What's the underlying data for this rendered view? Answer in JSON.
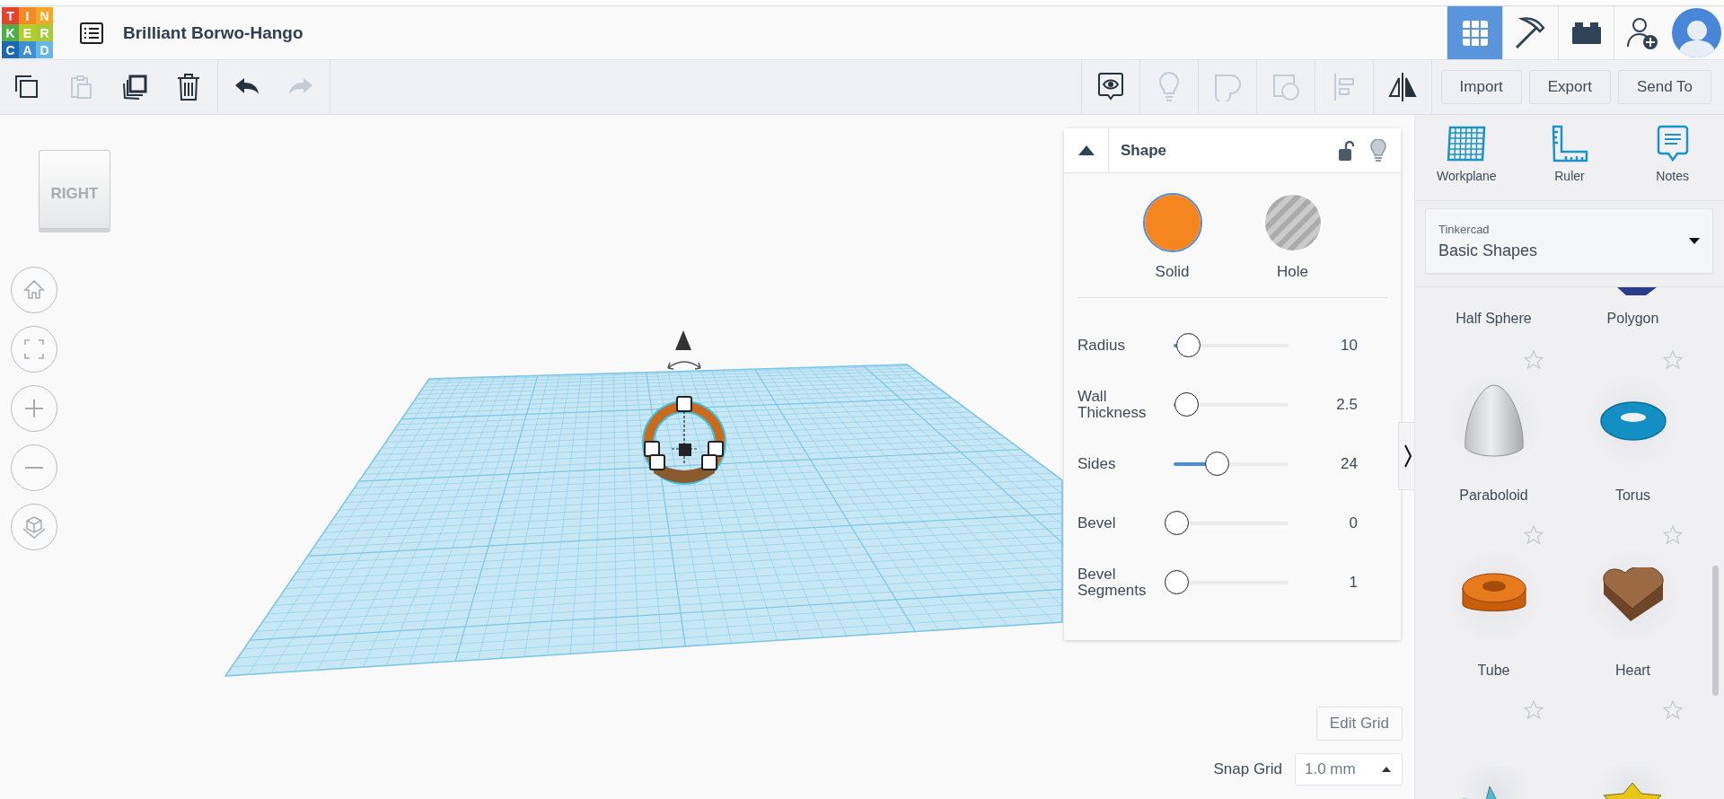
{
  "header": {
    "logo_letters": [
      "T",
      "I",
      "N",
      "K",
      "E",
      "R",
      "C",
      "A",
      "D"
    ],
    "title": "Brilliant Borwo-Hango",
    "views": [
      {
        "kind": "grid",
        "selected": true
      },
      {
        "kind": "pickaxe",
        "selected": false
      },
      {
        "kind": "bricks",
        "selected": false
      }
    ]
  },
  "toolbar": {
    "edit_tools": [
      {
        "kind": "copy",
        "disabled": false
      },
      {
        "kind": "paste",
        "disabled": true
      },
      {
        "kind": "duplicate",
        "disabled": false
      },
      {
        "kind": "delete",
        "disabled": false
      }
    ],
    "history": [
      {
        "kind": "undo",
        "disabled": false
      },
      {
        "kind": "redo",
        "disabled": true
      }
    ],
    "view_tools": [
      {
        "kind": "notes",
        "disabled": false
      },
      {
        "kind": "bulb",
        "disabled": true
      },
      {
        "kind": "group",
        "disabled": true
      },
      {
        "kind": "ungroup",
        "disabled": true
      },
      {
        "kind": "align",
        "disabled": true
      },
      {
        "kind": "mirror",
        "disabled": false
      }
    ],
    "buttons": [
      "Import",
      "Export",
      "Send To"
    ]
  },
  "view_cube": {
    "label": "RIGHT"
  },
  "shape_panel": {
    "title": "Shape",
    "modes": [
      {
        "label": "Solid",
        "kind": "solid",
        "selected": true
      },
      {
        "label": "Hole",
        "kind": "hole",
        "selected": false
      }
    ],
    "params": [
      {
        "name": "Radius",
        "level": 0.13,
        "value": "10"
      },
      {
        "name": "Wall Thickness",
        "level": 0.11,
        "value": "2.5"
      },
      {
        "name": "Sides",
        "level": 0.38,
        "value": "24"
      },
      {
        "name": "Bevel",
        "level": 0.03,
        "value": "0"
      },
      {
        "name": "Bevel Segments",
        "level": 0.03,
        "value": "1"
      }
    ]
  },
  "side_panel": {
    "tools": [
      {
        "label": "Workplane",
        "kind": "workplane"
      },
      {
        "label": "Ruler",
        "kind": "ruler"
      },
      {
        "label": "Notes",
        "kind": "notes"
      }
    ],
    "library": {
      "source": "Tinkercad",
      "category": "Basic Shapes"
    },
    "shapes": [
      {
        "label": "Half Sphere",
        "kind": "half-sphere"
      },
      {
        "label": "Polygon",
        "kind": "polygon"
      },
      {
        "label": "Paraboloid",
        "kind": "paraboloid"
      },
      {
        "label": "Torus",
        "kind": "torus"
      },
      {
        "label": "Tube",
        "kind": "tube"
      },
      {
        "label": "Heart",
        "kind": "heart"
      },
      {
        "kind": "star-faceted"
      },
      {
        "kind": "star-extruded"
      }
    ]
  },
  "grid_controls": {
    "edit_button": "Edit Grid",
    "snap_label": "Snap Grid",
    "snap_value": "1.0 mm"
  }
}
